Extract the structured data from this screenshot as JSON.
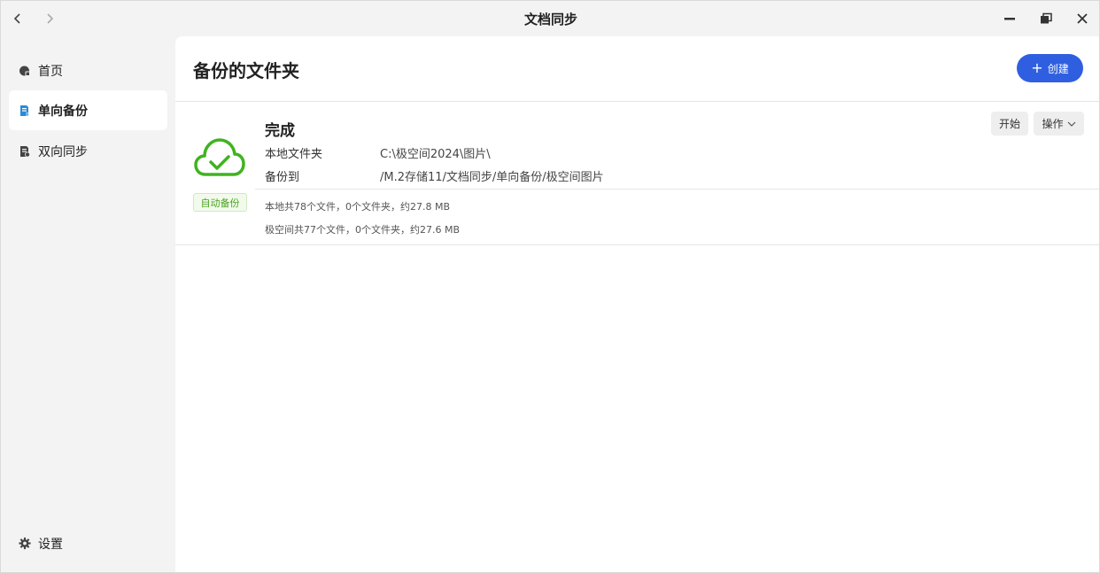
{
  "window": {
    "title": "文档同步"
  },
  "sidebar": {
    "items": [
      {
        "label": "首页",
        "icon": "home-icon"
      },
      {
        "label": "单向备份",
        "icon": "backup-doc-icon"
      },
      {
        "label": "双向同步",
        "icon": "sync-doc-icon"
      }
    ],
    "settings_label": "设置"
  },
  "main": {
    "title": "备份的文件夹",
    "create_label": "创建"
  },
  "task": {
    "status": "完成",
    "badge": "自动备份",
    "local_label": "本地文件夹",
    "local_path": "C:\\极空间2024\\图片\\",
    "target_label": "备份到",
    "target_path": "/M.2存储11/文档同步/单向备份/极空间图片",
    "local_stats": "本地共78个文件，0个文件夹，约27.8 MB",
    "remote_stats": "极空间共77个文件，0个文件夹，约27.6 MB",
    "start_label": "开始",
    "ops_label": "操作"
  },
  "colors": {
    "accent": "#2f5fe0",
    "success": "#3fb31f",
    "active_icon": "#2a8ad8"
  }
}
